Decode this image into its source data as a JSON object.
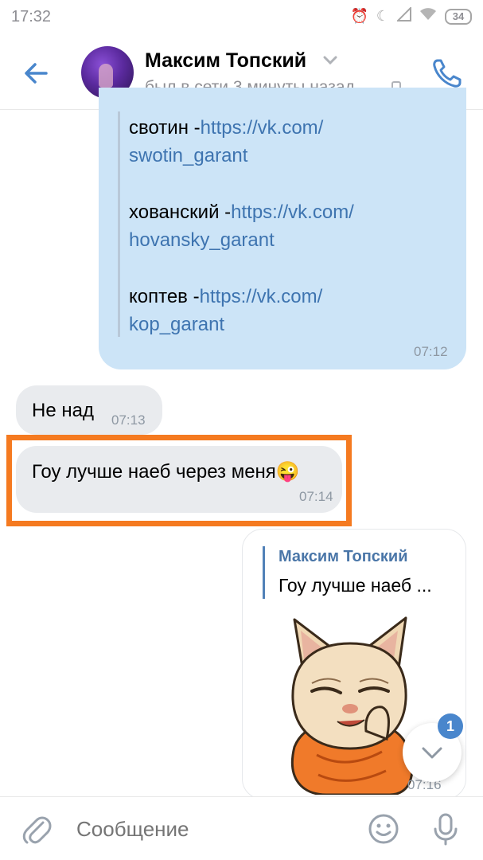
{
  "status_bar": {
    "time": "17:32",
    "battery": "34"
  },
  "header": {
    "contact_name": "Максим Топский",
    "contact_status": "был в сети 3 минуты назад"
  },
  "messages": {
    "links": [
      {
        "name": "свотин -",
        "url_line1": "https://vk.com/",
        "url_line2": "swotin_garant"
      },
      {
        "name": "хованский -",
        "url_line1": "https://vk.com/",
        "url_line2": "hovansky_garant"
      },
      {
        "name": "коптев -",
        "url_line1": "https://vk.com/",
        "url_line2": "kop_garant"
      }
    ],
    "links_time": "07:12",
    "msg1": {
      "text": "Не над",
      "time": "07:13"
    },
    "msg2": {
      "text": "Гоу лучше наеб через меня😜",
      "time": "07:14"
    },
    "reply": {
      "quoted_name": "Максим Топский",
      "quoted_text": "Гоу лучше наеб ...",
      "time": "07:16"
    }
  },
  "unread_count": "1",
  "composer": {
    "placeholder": "Сообщение"
  },
  "colors": {
    "accent": "#4986cc",
    "outgoing_bubble": "#cce4f7",
    "incoming_bubble": "#e9ebee",
    "highlight": "#f57a20"
  }
}
